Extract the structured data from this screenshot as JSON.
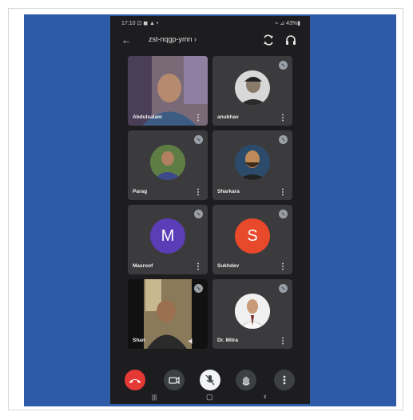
{
  "status_bar": {
    "time": "17:10 ⊡ ◼ ▲ •",
    "right": "⌁ ⊿ 43%▮"
  },
  "header": {
    "back_glyph": "←",
    "meeting_code": "zst-nqgp-ymn ›"
  },
  "participants": [
    {
      "name": "Abdulsalam",
      "type": "video"
    },
    {
      "name": "anubhav",
      "type": "photo"
    },
    {
      "name": "Parag",
      "type": "photo"
    },
    {
      "name": "Sharkara",
      "type": "photo"
    },
    {
      "name": "Masroof",
      "type": "letter",
      "letter": "M",
      "color": "#5b3db8"
    },
    {
      "name": "Sukhdev",
      "type": "letter",
      "letter": "S",
      "color": "#e8492a"
    },
    {
      "name": "Shan",
      "type": "video"
    },
    {
      "name": "Dr. Mitra",
      "type": "photo"
    }
  ],
  "tile_more_glyph": "⋮",
  "nav_glyphs": {
    "recents": "|||",
    "home": "▢",
    "back": "‹"
  },
  "colors": {
    "background_blue": "#2d5ba8",
    "end_call_red": "#e53935",
    "tile_bg": "#3b3b3d"
  }
}
